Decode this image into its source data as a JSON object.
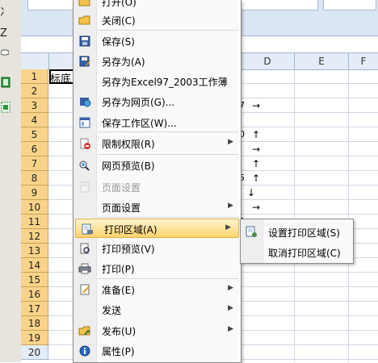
{
  "left_strip": {
    "glyph_top": "冫",
    "glyph_z": "Z"
  },
  "menu": {
    "top_partial_label": "打开(O)",
    "items": [
      {
        "label": "关闭(C)",
        "icon": "folder-close-icon",
        "submenu": false,
        "disabled": false
      },
      {
        "label": "保存(S)",
        "icon": "save-icon",
        "submenu": false,
        "disabled": false
      },
      {
        "label": "另存为(A)",
        "icon": "save-as-icon",
        "submenu": false,
        "disabled": false
      },
      {
        "label": "另存为Excel97_2003工作薄",
        "icon": "",
        "submenu": false,
        "disabled": false
      },
      {
        "label": "另存为网页(G)...",
        "icon": "save-web-icon",
        "submenu": false,
        "disabled": false
      },
      {
        "label": "保存工作区(W)...",
        "icon": "workspace-icon",
        "submenu": false,
        "disabled": false
      },
      {
        "label": "限制权限(R)",
        "icon": "permission-icon",
        "submenu": true,
        "disabled": false
      },
      {
        "label": "网页预览(B)",
        "icon": "web-preview-icon",
        "submenu": false,
        "disabled": false
      },
      {
        "label": "页面设置",
        "icon": "page-setup-icon",
        "submenu": false,
        "disabled": true
      },
      {
        "label": "页面设置",
        "icon": "",
        "submenu": true,
        "disabled": false
      },
      {
        "label": "打印区域(A)",
        "icon": "print-area-icon",
        "submenu": true,
        "disabled": false,
        "active": true
      },
      {
        "label": "打印预览(V)",
        "icon": "print-preview-icon",
        "submenu": false,
        "disabled": false
      },
      {
        "label": "打印(P)",
        "icon": "print-icon",
        "submenu": false,
        "disabled": false
      },
      {
        "label": "准备(E)",
        "icon": "prepare-icon",
        "submenu": true,
        "disabled": false
      },
      {
        "label": "发送",
        "icon": "",
        "submenu": true,
        "disabled": false
      },
      {
        "label": "发布(U)",
        "icon": "publish-icon",
        "submenu": true,
        "disabled": false
      },
      {
        "label": "属性(P)",
        "icon": "properties-icon",
        "submenu": false,
        "disabled": false
      }
    ]
  },
  "submenu": {
    "items": [
      {
        "label": "设置打印区域(S)",
        "icon": "set-print-area-icon"
      },
      {
        "label": "取消打印区域(C)",
        "icon": ""
      }
    ]
  },
  "sheet": {
    "columns": [
      "D",
      "E",
      "F"
    ],
    "rows": [
      "1",
      "2",
      "3",
      "4",
      "5",
      "6",
      "7",
      "8",
      "9",
      "10",
      "11",
      "12",
      "13",
      "14",
      "15",
      "16",
      "17",
      "18",
      "19",
      "20"
    ],
    "cell_a1": "标底",
    "col_c_fragments": [
      "7",
      "0",
      "",
      "",
      "5",
      "",
      "",
      "0"
    ],
    "arrows": [
      "→",
      "↑",
      "→",
      "↑",
      "↑",
      "↓",
      "→",
      "→"
    ]
  },
  "colors": {
    "selected_row_header": "#f8d48a",
    "menu_highlight": "#ffd36e",
    "ribbon": "#dbe6f4"
  }
}
